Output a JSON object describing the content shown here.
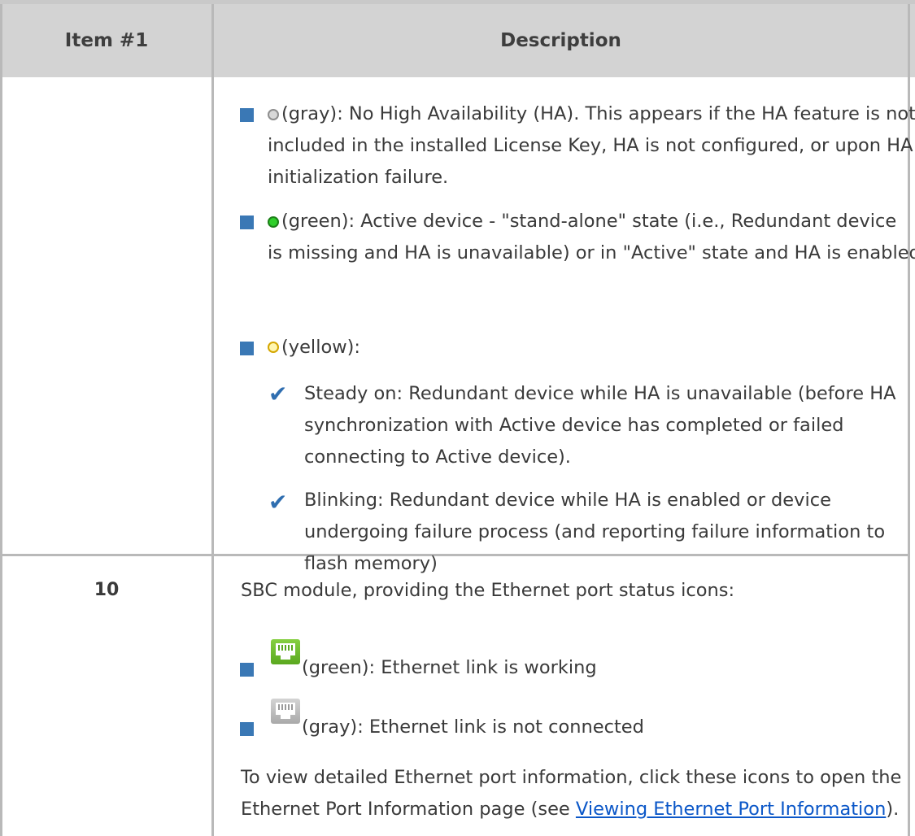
{
  "table": {
    "headers": [
      "Item #1",
      "Description"
    ],
    "rows": [
      {
        "item": "",
        "description": {
          "lines": [
            "(gray): No High Availability (HA). This appears if the HA feature is not",
            "included in the installed License Key, HA is not configured, or upon HA",
            "initialization failure.",
            "(green): Active device - \"stand-alone\" state (i.e., Redundant device",
            "is missing and HA is unavailable) or in \"Active\" state and HA is enabled",
            "(yellow):",
            "Steady on: Redundant device while HA is unavailable (before HA",
            "synchronization with Active device has completed or failed",
            "connecting to Active device).",
            "Blinking: Redundant device while HA is enabled or device",
            "undergoing failure process (and reporting failure information to",
            "flash memory)"
          ]
        }
      },
      {
        "item": "10",
        "description": {
          "intro": "SBC module, providing the Ethernet port status icons:",
          "green_line": "(green): Ethernet link is working",
          "gray_line": "(gray): Ethernet link is not connected",
          "note_line1": "To view detailed Ethernet port information, click these icons to open the",
          "note_line2_prefix": "Ethernet Port Information page (see ",
          "note_link": "Viewing Ethernet Port Information",
          "note_line2_suffix": ")."
        }
      }
    ]
  },
  "icons": {
    "bullet": "blue-square-bullet",
    "check": "check-mark",
    "led_gray": "gray-led",
    "led_green": "green-led",
    "led_yellow": "yellow-led",
    "eth_green": "green-ethernet-port",
    "eth_gray": "gray-ethernet-port"
  },
  "colors": {
    "header_bg": "#d3d3d3",
    "bullet": "#3a78b5",
    "link": "#0b57c8"
  }
}
